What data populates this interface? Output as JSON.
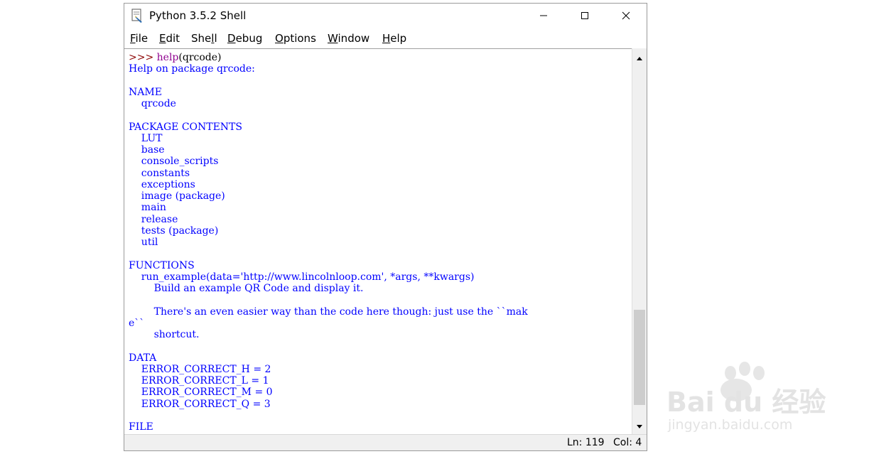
{
  "window": {
    "title": "Python 3.5.2 Shell"
  },
  "menu": [
    {
      "pre": "",
      "key": "F",
      "post": "ile"
    },
    {
      "pre": "",
      "key": "E",
      "post": "dit"
    },
    {
      "pre": "She",
      "key": "l",
      "post": "l"
    },
    {
      "pre": "",
      "key": "D",
      "post": "ebug"
    },
    {
      "pre": "",
      "key": "O",
      "post": "ptions"
    },
    {
      "pre": "",
      "key": "W",
      "post": "indow"
    },
    {
      "pre": "",
      "key": "H",
      "post": "elp"
    }
  ],
  "shell": {
    "prompt": ">>> ",
    "command_func": "help",
    "command_args": "(qrcode)",
    "output": [
      "Help on package qrcode:",
      "",
      "NAME",
      "    qrcode",
      "",
      "PACKAGE CONTENTS",
      "    LUT",
      "    base",
      "    console_scripts",
      "    constants",
      "    exceptions",
      "    image (package)",
      "    main",
      "    release",
      "    tests (package)",
      "    util",
      "",
      "FUNCTIONS",
      "    run_example(data='http://www.lincolnloop.com', *args, **kwargs)",
      "        Build an example QR Code and display it.",
      "",
      "        There's an even easier way than the code here though: just use the ``mak",
      "e``",
      "        shortcut.",
      "",
      "DATA",
      "    ERROR_CORRECT_H = 2",
      "    ERROR_CORRECT_L = 1",
      "    ERROR_CORRECT_M = 0",
      "    ERROR_CORRECT_Q = 3",
      "",
      "FILE"
    ]
  },
  "status": {
    "ln": "Ln: 119",
    "col": "Col: 4"
  },
  "watermark": {
    "brand": "Bai du 经验",
    "url": "jingyan.baidu.com"
  },
  "colors": {
    "output": "#0000ff",
    "prompt": "#8b0000",
    "builtin": "#900090"
  }
}
